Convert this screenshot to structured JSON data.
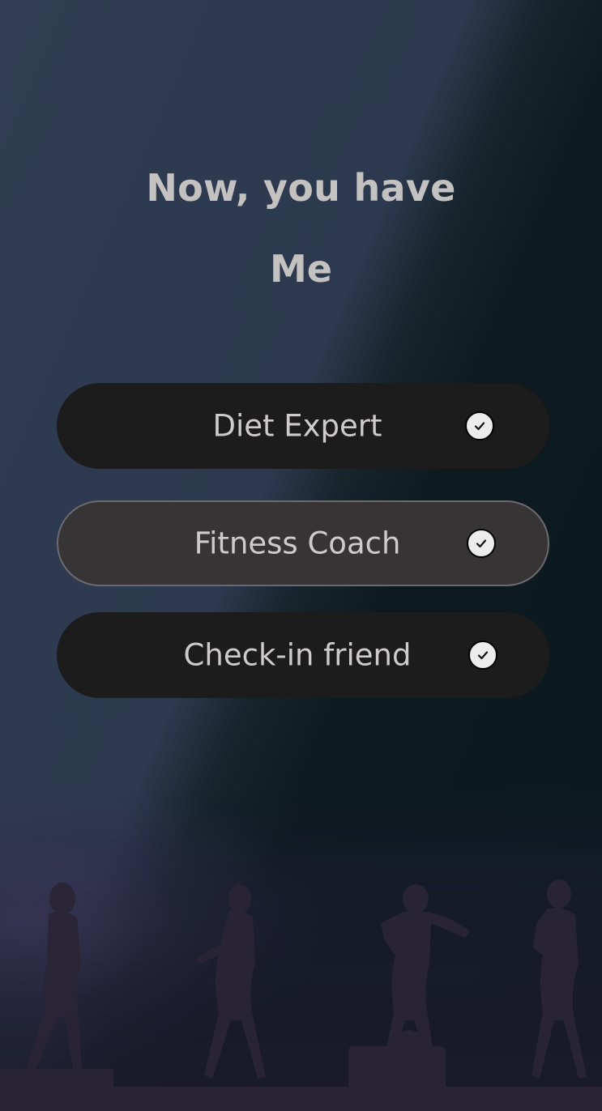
{
  "heading": {
    "line1": "Now, you have",
    "line2": "Me"
  },
  "options": [
    {
      "label": "Diet Expert",
      "icon": "check-circle-icon",
      "selected": false
    },
    {
      "label": "Fitness Coach",
      "icon": "check-circle-icon",
      "selected": true
    },
    {
      "label": "Check-in friend",
      "icon": "check-circle-icon",
      "selected": false
    }
  ],
  "colors": {
    "heading_text": "#c4c2c0",
    "button_bg": "#1c1c1c",
    "button_selected_bg": "#373436",
    "button_text": "#cdcbcb"
  }
}
